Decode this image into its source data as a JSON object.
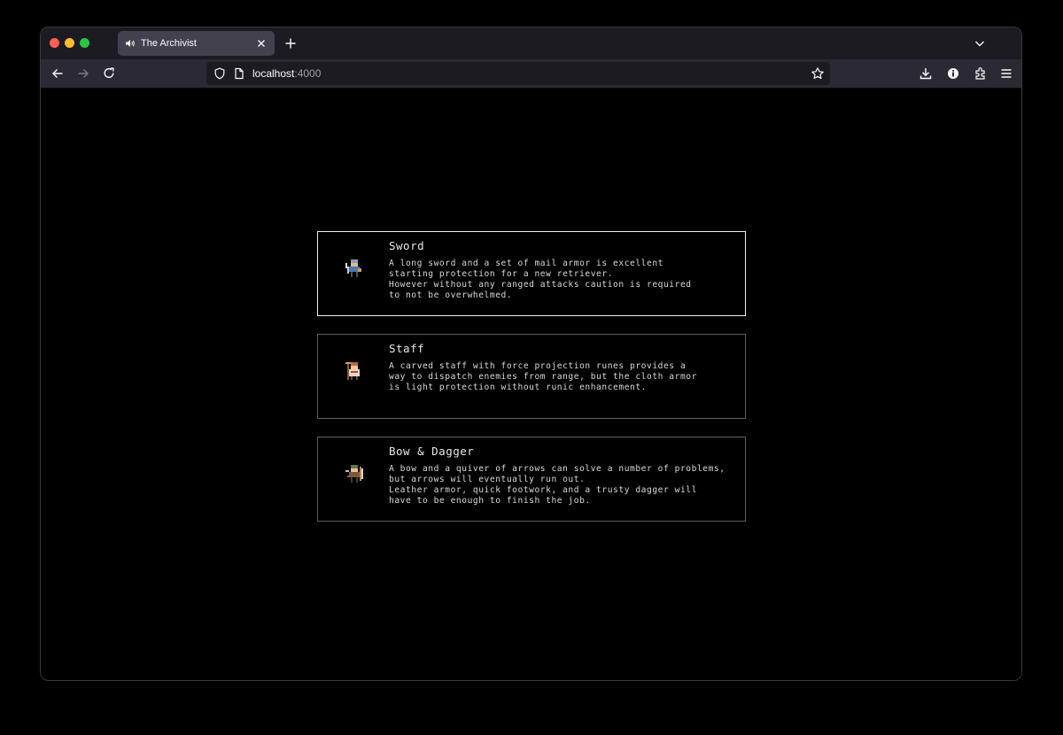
{
  "browser": {
    "tab_title": "The Archivist",
    "url_host": "localhost",
    "url_port": ":4000"
  },
  "icons": {
    "speaker": "speaker-icon",
    "close": "close-icon",
    "new_tab": "plus-icon",
    "tab_list": "chevron-down-icon",
    "back": "back-arrow-icon",
    "forward": "forward-arrow-icon",
    "reload": "reload-icon",
    "shield": "shield-icon",
    "page": "page-icon",
    "bookmark": "star-icon",
    "downloads": "download-icon",
    "extension_1": "info-icon",
    "extensions": "puzzle-icon",
    "menu": "hamburger-menu-icon"
  },
  "classes": [
    {
      "title": "Sword",
      "description": "A long sword and a set of mail armor is excellent\nstarting protection for a new retriever.\nHowever without any ranged attacks caution is required\nto not be overwhelmed.",
      "sprite": "sword-warrior-sprite",
      "selected": true
    },
    {
      "title": "Staff",
      "description": "A carved staff with force projection runes provides a\nway to dispatch enemies from range, but the cloth armor\nis light protection without runic enhancement.",
      "sprite": "staff-mage-sprite",
      "selected": false
    },
    {
      "title": "Bow & Dagger",
      "description": "A bow and a quiver of arrows can solve a number of problems,\nbut arrows will eventually run out.\nLeather armor, quick footwork, and a trusty dagger will\nhave to be enough to finish the job.",
      "sprite": "bow-ranger-sprite",
      "selected": false
    }
  ],
  "colors": {
    "card_border": "#6b5a4c",
    "card_border_selected": "#f0f0f0",
    "background": "#000000"
  }
}
